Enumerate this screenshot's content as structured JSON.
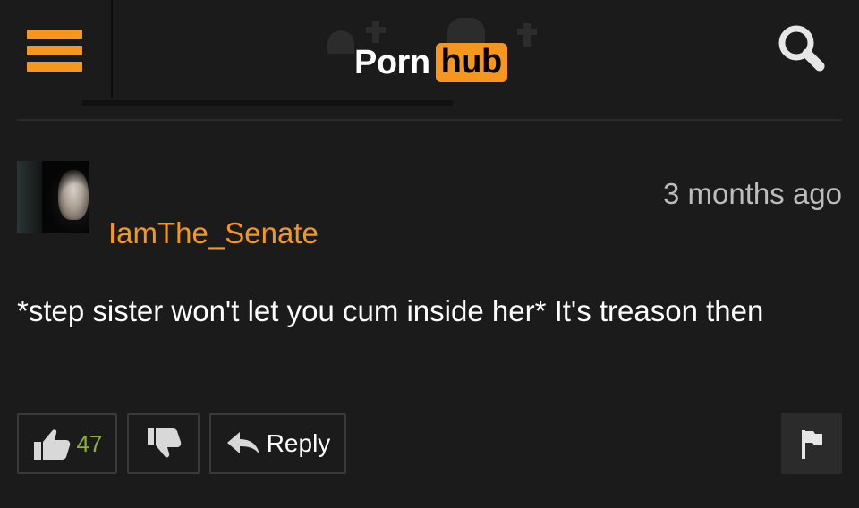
{
  "header": {
    "menu_icon": "hamburger-menu-icon",
    "logo": {
      "part1": "Porn",
      "part2": "hub"
    },
    "search_icon": "search-icon",
    "accent_color": "#f6961c"
  },
  "comment": {
    "username": "IamThe_Senate",
    "timestamp": "3 months ago",
    "text": "*step sister won't let you cum inside her* It's treason then",
    "actions": {
      "upvote_icon": "thumbs-up-icon",
      "upvote_count": "47",
      "downvote_icon": "thumbs-down-icon",
      "reply_icon": "reply-arrow-icon",
      "reply_label": "Reply",
      "flag_icon": "flag-icon"
    }
  }
}
